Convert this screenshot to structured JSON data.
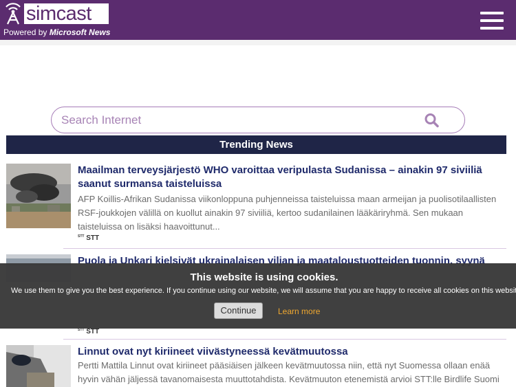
{
  "header": {
    "logo_text": "simcast",
    "powered_prefix": "Powered by",
    "powered_brand": "Microsoft News",
    "colors": {
      "brand": "#5b2c6f",
      "nav": "#1f2547"
    }
  },
  "search": {
    "placeholder": "Search Internet"
  },
  "trending": {
    "label": "Trending News"
  },
  "news": [
    {
      "title": "Maailman terveysjärjestö WHO varoittaa veripulasta Sudanissa – ainakin 97 siviiliä saanut surmansa taisteluissa",
      "description": "AFP Koillis-Afrikan Sudanissa viikonloppuna puhjenneissa taisteluissa maan armeijan ja puolisotilaallisten RSF-joukkojen välillä on kuollut ainakin 97 siviiliä, kertoo sudanilainen lääkäriryhmä. Sen mukaan taisteluissa on lisäksi haavoittunut...",
      "source_logo": "STT",
      "source": "STT"
    },
    {
      "title": "Puola ja Unkari kielsivät ukrainalaisen viljan ja maataloustuotteiden tuonnin, syynä",
      "source_logo": "STT",
      "source": "STT"
    },
    {
      "title": "Linnut ovat nyt kiriineet viivästyneessä kevätmuutossa",
      "description": "Pertti Mattila Linnut ovat kiriineet pääsiäisen jälkeen kevätmuutossa niin, että nyt Suomessa ollaan enää hyvin vähän jäljessä tavanomaisesta muuttotahdista. Kevätmuuton etenemistä arvioi STT:lle Birdlife Suomi -"
    }
  ],
  "cookie": {
    "title": "This website is using cookies.",
    "text": "We use them to give you the best experience. If you continue using our website, we will assume that you are happy to receive all cookies on this website.",
    "continue_label": "Continue",
    "learn_label": "Learn more"
  }
}
